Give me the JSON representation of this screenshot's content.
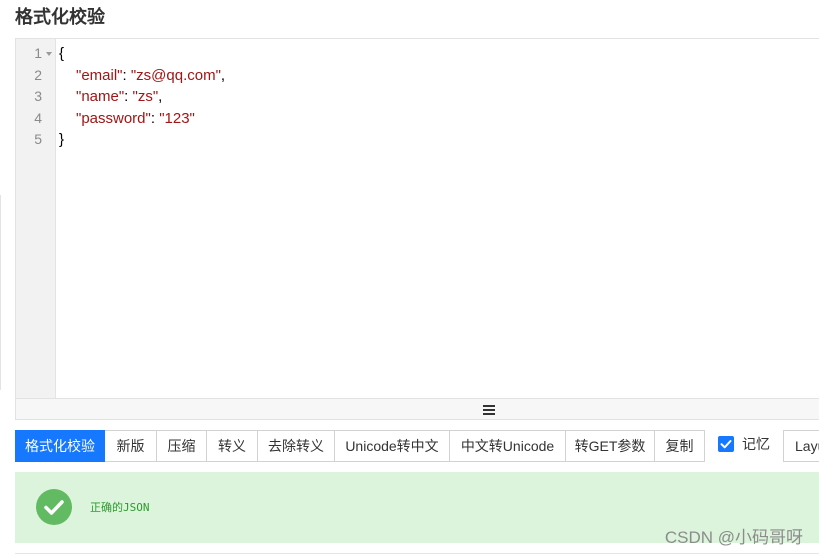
{
  "page": {
    "title": "格式化校验"
  },
  "editor": {
    "fold_icon": "fold-arrow-icon",
    "line_numbers": [
      "1",
      "2",
      "3",
      "4",
      "5"
    ],
    "lines": [
      {
        "brace": "{"
      },
      {
        "key": "\"email\"",
        "colon": ": ",
        "value": "\"zs@qq.com\"",
        "comma": ","
      },
      {
        "key": "\"name\"",
        "colon": ": ",
        "value": "\"zs\"",
        "comma": ","
      },
      {
        "key": "\"password\"",
        "colon": ": ",
        "value": "\"123\""
      },
      {
        "brace": "}"
      }
    ],
    "resize_icon": "hamburger-icon"
  },
  "toolbar": {
    "buttons": [
      {
        "label": "格式化校验",
        "active": true
      },
      {
        "label": "新版",
        "active": false
      },
      {
        "label": "压缩",
        "active": false
      },
      {
        "label": "转义",
        "active": false
      },
      {
        "label": "去除转义",
        "active": false
      },
      {
        "label": "Unicode转中文",
        "active": false
      },
      {
        "label": "中文转Unicode",
        "active": false
      },
      {
        "label": "转GET参数",
        "active": false
      },
      {
        "label": "复制",
        "active": false
      }
    ],
    "remember": {
      "label": "记忆",
      "checked": true,
      "icon": "checkbox-check-icon"
    },
    "layout_button": {
      "label": "Layu"
    }
  },
  "result": {
    "icon": "check-circle-icon",
    "message": "正确的JSON"
  },
  "watermark": {
    "text": "CSDN @小码哥呀"
  },
  "colors": {
    "accent": "#1677ff",
    "string": "#a31515",
    "success_bg": "#dcf4dc",
    "success_icon": "#62bb62",
    "success_text": "#2d9a2d"
  }
}
